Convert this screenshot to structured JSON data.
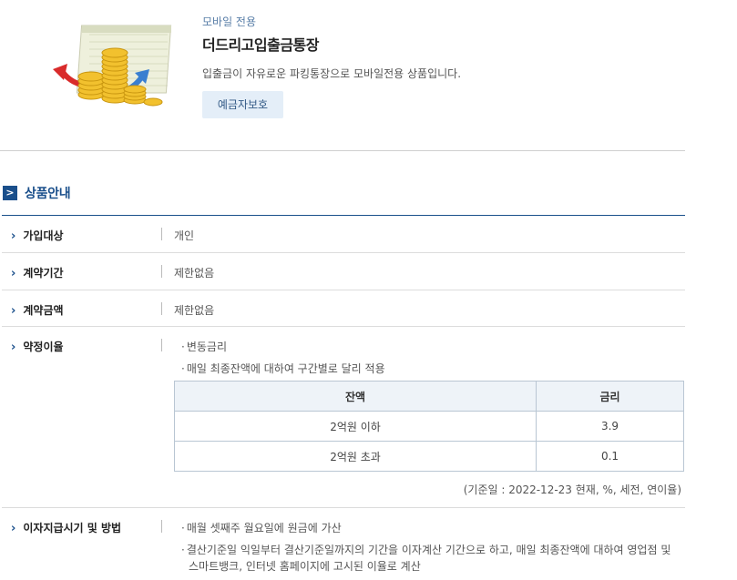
{
  "product": {
    "channel": "모바일 전용",
    "name": "더드리고입출금통장",
    "description": "입출금이 자유로운 파킹통장으로 모바일전용 상품입니다.",
    "badge": "예금자보호",
    "image_icon": "passbook-coins-image"
  },
  "section": {
    "title": "상품안내"
  },
  "info": {
    "target": {
      "label": "가입대상",
      "value": "개인"
    },
    "period": {
      "label": "계약기간",
      "value": "제한없음"
    },
    "amount": {
      "label": "계약금액",
      "value": "제한없음"
    },
    "rate": {
      "label": "약정이율",
      "bullets": [
        "변동금리",
        "매일 최종잔액에 대하여 구간별로 달리 적용"
      ],
      "table": {
        "headers": [
          "잔액",
          "금리"
        ],
        "rows": [
          [
            "2억원 이하",
            "3.9"
          ],
          [
            "2억원 초과",
            "0.1"
          ]
        ]
      },
      "note": "(기준일 : 2022-12-23 현재, %, 세전, 연이율)"
    },
    "interest": {
      "label": "이자지급시기 및 방법",
      "bullets": [
        "매월 셋째주 월요일에 원금에 가산",
        "결산기준일 익일부터 결산기준일까지의 기간을 이자계산 기간으로 하고, 매일 최종잔액에 대하여 영업점 및",
        "스마트뱅크, 인터넷 홈페이지에 고시된 이율로 계산"
      ]
    }
  },
  "colors": {
    "accent": "#1a4f8b",
    "badge_bg": "#e4eef8",
    "table_header_bg": "#eef3f8"
  }
}
